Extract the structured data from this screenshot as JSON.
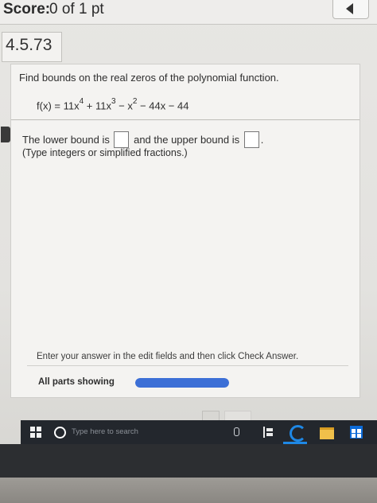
{
  "header": {
    "score_label": "Score:",
    "score_value": "0 of 1 pt"
  },
  "question": {
    "number": "4.5.73",
    "prompt": "Find bounds on the real zeros of the polynomial function.",
    "formula": {
      "lhs": "f(x) = 11x",
      "exp1": "4",
      "mid1": " + 11x",
      "exp2": "3",
      "mid2": " − x",
      "exp3": "2",
      "tail": " − 44x − 44"
    },
    "answer_prefix": "The lower bound is",
    "answer_middle": "and the upper bound is",
    "answer_suffix": ".",
    "hint": "(Type integers or simplified fractions.)"
  },
  "footer": {
    "instruction": "Enter your answer in the edit fields and then click Check Answer.",
    "parts_label": "All parts showing",
    "progress_fraction": 1.0
  },
  "taskbar": {
    "search_placeholder": "Type here to search"
  },
  "colors": {
    "progress": "#3c6fd6",
    "taskbar": "#23272d",
    "edge": "#1e88e5"
  }
}
